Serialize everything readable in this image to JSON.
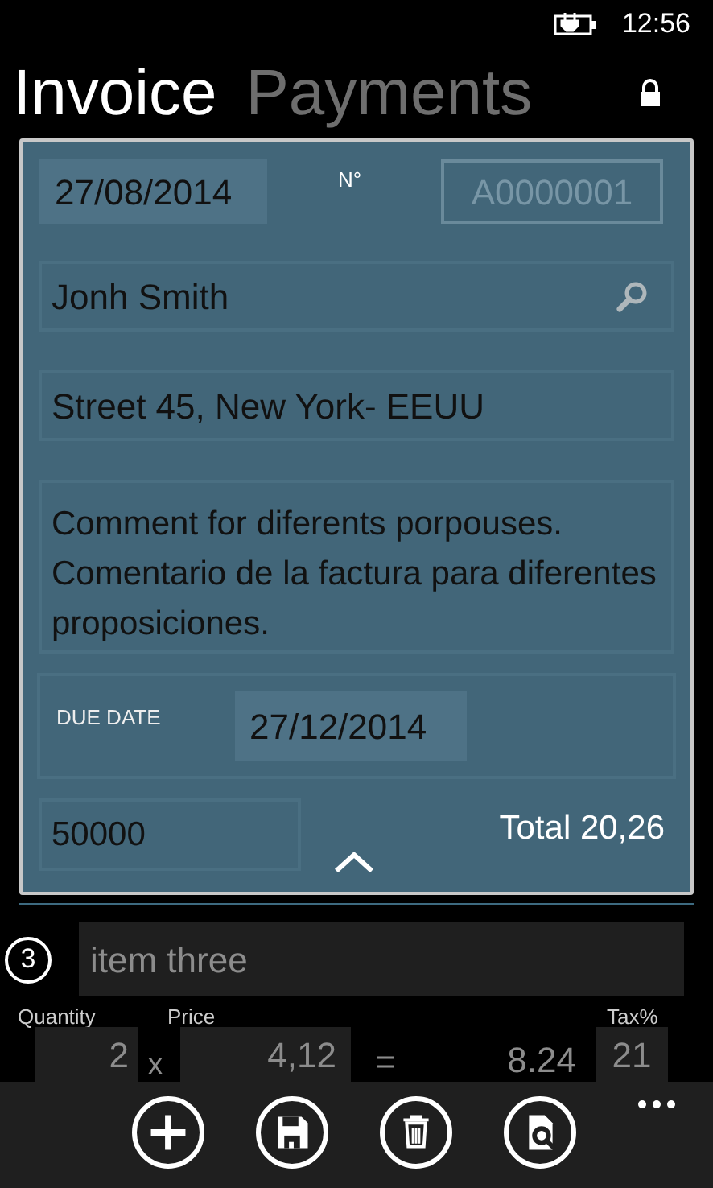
{
  "status_bar": {
    "time": "12:56"
  },
  "pivot": [
    {
      "label": "Invoice",
      "selected": true
    },
    {
      "label": "Payments",
      "selected": false
    }
  ],
  "invoice": {
    "date": "27/08/2014",
    "number_label": "N°",
    "number": {
      "value": "A0000001",
      "disabled": true
    },
    "customer": "Jonh Smith",
    "address": "Street 45, New York- EEUU",
    "comment": "Comment for diferents porpouses. Comentario de la factura para diferentes proposiciones.",
    "due_date_label": "DUE DATE",
    "due_date": "27/12/2014",
    "code": "50000",
    "total": "Total 20,26"
  },
  "item": {
    "index": "3",
    "name": "item three",
    "quantity_label": "Quantity",
    "price_label": "Price",
    "tax_label": "Tax%",
    "quantity": "2",
    "times": "x",
    "price": "4,12",
    "equals": "=",
    "amount": "8.24",
    "tax": "21"
  },
  "app_bar": {
    "buttons": [
      {
        "kind": "add"
      },
      {
        "kind": "save"
      },
      {
        "kind": "delete"
      },
      {
        "kind": "preview"
      }
    ]
  }
}
